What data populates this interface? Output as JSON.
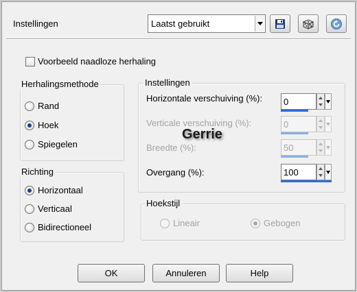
{
  "header": {
    "title": "Instellingen",
    "preset_value": "Laatst gebruikt",
    "icons": [
      "save-icon",
      "randomize-dice-icon",
      "reset-icon"
    ]
  },
  "seamless_preview": {
    "label": "Voorbeeld naadloze herhaling",
    "checked": false
  },
  "repeat_method": {
    "title": "Herhalingsmethode",
    "options": [
      {
        "label": "Rand",
        "checked": false
      },
      {
        "label": "Hoek",
        "checked": true
      },
      {
        "label": "Spiegelen",
        "checked": false
      }
    ]
  },
  "direction": {
    "title": "Richting",
    "options": [
      {
        "label": "Horizontaal",
        "checked": true
      },
      {
        "label": "Verticaal",
        "checked": false
      },
      {
        "label": "Bidirectioneel",
        "checked": false
      }
    ]
  },
  "settings": {
    "title": "Instellingen",
    "fields": [
      {
        "label": "Horizontale verschuiving (%):",
        "value": "0",
        "enabled": true,
        "fill": 0.0
      },
      {
        "label": "Verticale verschuiving (%):",
        "value": "0",
        "enabled": false,
        "fill": 0.0
      },
      {
        "label": "Breedte (%):",
        "value": "50",
        "enabled": false,
        "fill": 0.5
      },
      {
        "label": "Overgang (%):",
        "value": "100",
        "enabled": true,
        "fill": 1.0
      }
    ]
  },
  "corner_style": {
    "title": "Hoekstijl",
    "options": [
      {
        "label": "Lineair",
        "checked": false
      },
      {
        "label": "Gebogen",
        "checked": true
      }
    ]
  },
  "watermark": "Gerrie",
  "buttons": {
    "ok": "OK",
    "cancel": "Annuleren",
    "help": "Help"
  },
  "colors": {
    "accent": "#2f6fd8",
    "disabled_text": "#a3a3a3"
  }
}
